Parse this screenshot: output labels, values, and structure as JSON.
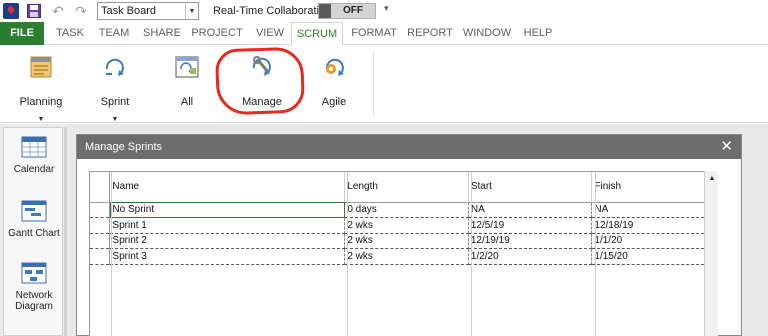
{
  "quick_access": {
    "view_selector": "Task Board",
    "collab_label": "Real-Time Collaboration",
    "collab_state": "OFF"
  },
  "tabs": [
    "FILE",
    "TASK",
    "TEAM",
    "SHARE",
    "PROJECT",
    "VIEW",
    "SCRUM",
    "FORMAT",
    "REPORT",
    "WINDOW",
    "HELP"
  ],
  "active_tab": "SCRUM",
  "ribbon": {
    "buttons": [
      {
        "label": "Planning",
        "icon": "planning-icon",
        "dropdown": true
      },
      {
        "label": "Sprint",
        "icon": "sprint-icon",
        "dropdown": true
      },
      {
        "label": "All",
        "icon": "all-sprints-icon",
        "dropdown": false
      },
      {
        "label": "Manage",
        "icon": "manage-sprints-icon",
        "dropdown": false,
        "highlighted": true
      },
      {
        "label": "Agile",
        "icon": "agile-icon",
        "dropdown": false
      }
    ]
  },
  "sidebar": {
    "items": [
      {
        "label": "Calendar",
        "icon": "calendar-icon"
      },
      {
        "label": "Gantt Chart",
        "icon": "gantt-chart-icon"
      },
      {
        "label": "Network Diagram",
        "icon": "network-diagram-icon"
      }
    ]
  },
  "dialog": {
    "title": "Manage Sprints",
    "columns": [
      "Name",
      "Length",
      "Start",
      "Finish"
    ],
    "rows": [
      {
        "name": "No Sprint",
        "length": "0 days",
        "start": "NA",
        "finish": "NA"
      },
      {
        "name": "Sprint 1",
        "length": "2 wks",
        "start": "12/5/19",
        "finish": "12/18/19"
      },
      {
        "name": "Sprint 2",
        "length": "2 wks",
        "start": "12/19/19",
        "finish": "1/1/20"
      },
      {
        "name": "Sprint 3",
        "length": "2 wks",
        "start": "1/2/20",
        "finish": "1/15/20"
      }
    ]
  },
  "colors": {
    "accent_green": "#2b7d2f",
    "highlight_red": "#e8291c",
    "dialog_title_bg": "#6d6d6d"
  }
}
